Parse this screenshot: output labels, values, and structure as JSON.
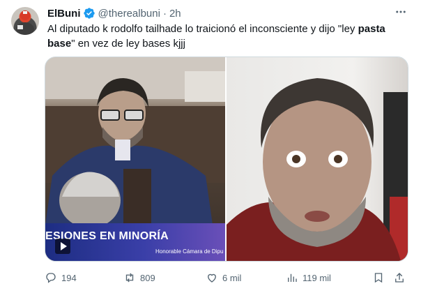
{
  "author": {
    "name": "ElBuni",
    "handle": "@therealbuni",
    "separator": "·",
    "time": "2h"
  },
  "tweet": {
    "text_part1": "Al diputado k rodolfo tailhade lo traicionó el inconsciente y dijo \"ley ",
    "text_bold": "pasta base",
    "text_part2": "\" en vez de ley bases kjjj"
  },
  "media": {
    "lower_third_title": "ESIONES EN MINORÍA",
    "lower_third_sub": "Honorable Cámara de Dipu"
  },
  "actions": {
    "replies": "194",
    "reposts": "809",
    "likes": "6 mil",
    "views": "119 mil"
  },
  "icons": [
    "verified-badge-icon",
    "more-icon",
    "play-icon",
    "reply-icon",
    "repost-icon",
    "like-icon",
    "views-icon",
    "bookmark-icon",
    "share-icon"
  ],
  "colors": {
    "verified": "#1d9bf0",
    "secondary_text": "#536471",
    "lower_third": "#2a3394"
  }
}
